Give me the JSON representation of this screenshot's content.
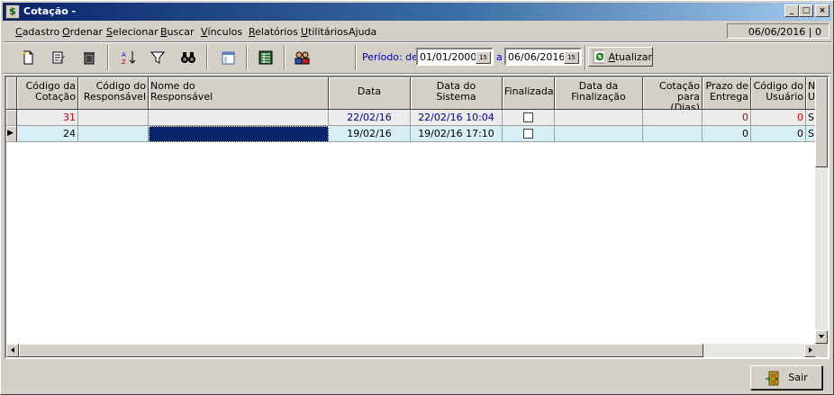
{
  "window": {
    "title": "Cotação -",
    "app_icon": "$",
    "controls": [
      "_",
      "□",
      "×"
    ]
  },
  "menu": {
    "items": [
      {
        "label": "Cadastro",
        "mnemonic": "C"
      },
      {
        "label": "Ordenar",
        "mnemonic": "O"
      },
      {
        "label": "Selecionar",
        "mnemonic": "S"
      },
      {
        "label": "Buscar",
        "mnemonic": "B"
      },
      {
        "label": "Vínculos",
        "mnemonic": "V"
      },
      {
        "label": "Relatórios",
        "mnemonic": "R"
      },
      {
        "label": "Utilitários",
        "mnemonic": "U"
      },
      {
        "label": "Ajuda",
        "mnemonic": ""
      }
    ],
    "status_date": "06/06/2016 | 0"
  },
  "toolbar": {
    "icons": [
      "new-document-icon",
      "edit-icon",
      "delete-trash-icon",
      "sort-az-icon",
      "filter-icon",
      "find-binoculars-icon",
      "window-icon",
      "spreadsheet-icon",
      "users-icon"
    ],
    "period_label": "Período: de",
    "date_from": "01/01/2000",
    "to_label": "a",
    "date_to": "06/06/2016",
    "calendar_label": "15",
    "refresh_label": "Atualizar",
    "refresh_mnemonic": "A"
  },
  "grid": {
    "columns": [
      {
        "line1": "Código da",
        "line2": "Cotação"
      },
      {
        "line1": "Código do",
        "line2": "Responsável"
      },
      {
        "line1": "Nome do",
        "line2": "Responsável"
      },
      {
        "line1": "Data",
        "line2": ""
      },
      {
        "line1": "Data do",
        "line2": "Sistema"
      },
      {
        "line1": "Finalizada",
        "line2": ""
      },
      {
        "line1": "Data da",
        "line2": "Finalização"
      },
      {
        "line1": "Cotação",
        "line2": "para (Dias)"
      },
      {
        "line1": "Prazo de",
        "line2": "Entrega"
      },
      {
        "line1": "Código do",
        "line2": "Usuário"
      },
      {
        "line1": "N",
        "line2": "U"
      }
    ],
    "rows": [
      {
        "cotacao": "31",
        "cod_resp": "",
        "nome_resp": "",
        "data": "22/02/16",
        "data_sistema": "22/02/16 10:04",
        "finalizada": false,
        "data_finalizacao": "",
        "cotacao_dias": "",
        "prazo": "0",
        "cod_usuario": "0",
        "nu": "S"
      },
      {
        "cotacao": "24",
        "cod_resp": "",
        "nome_resp": "",
        "data": "19/02/16",
        "data_sistema": "19/02/16 17:10",
        "finalizada": false,
        "data_finalizacao": "",
        "cotacao_dias": "",
        "prazo": "0",
        "cod_usuario": "0",
        "nu": "S"
      }
    ],
    "current_row_marker": "▶"
  },
  "footer": {
    "exit_label": "Sair"
  },
  "colors": {
    "title_start": "#0a246a",
    "title_end": "#a6caf0",
    "row1_text": "#c00000",
    "row1_date_text": "#000080",
    "row2_bg": "#d6eef4",
    "selected_cell": "#0a246a",
    "period_label": "#0000c0"
  }
}
